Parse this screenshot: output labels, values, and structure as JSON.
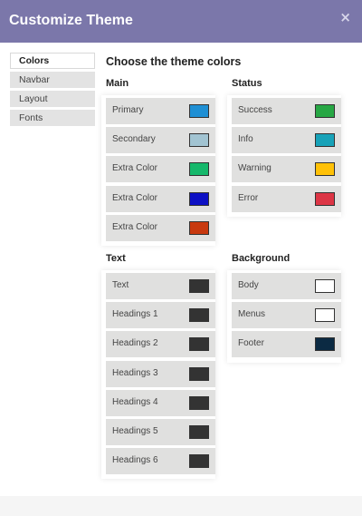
{
  "dialog": {
    "title": "Customize Theme",
    "close_glyph": "×"
  },
  "sidebar": {
    "items": [
      {
        "label": "Colors",
        "active": true
      },
      {
        "label": "Navbar",
        "active": false
      },
      {
        "label": "Layout",
        "active": false
      },
      {
        "label": "Fonts",
        "active": false
      }
    ]
  },
  "main": {
    "title": "Choose the theme colors",
    "groups": {
      "main": {
        "title": "Main",
        "items": [
          {
            "label": "Primary",
            "color": "#1e8fd4"
          },
          {
            "label": "Secondary",
            "color": "#a2c4d2"
          },
          {
            "label": "Extra Color",
            "color": "#16b86b"
          },
          {
            "label": "Extra Color",
            "color": "#0d10c4"
          },
          {
            "label": "Extra Color",
            "color": "#c8390f"
          }
        ]
      },
      "status": {
        "title": "Status",
        "items": [
          {
            "label": "Success",
            "color": "#27a744"
          },
          {
            "label": "Info",
            "color": "#17a2b8"
          },
          {
            "label": "Warning",
            "color": "#ffc107"
          },
          {
            "label": "Error",
            "color": "#dc3545"
          }
        ]
      },
      "text": {
        "title": "Text",
        "items": [
          {
            "label": "Text",
            "color": "#333333"
          },
          {
            "label": "Headings 1",
            "color": "#333333"
          },
          {
            "label": "Headings 2",
            "color": "#333333"
          },
          {
            "label": "Headings 3",
            "color": "#333333"
          },
          {
            "label": "Headings 4",
            "color": "#333333"
          },
          {
            "label": "Headings 5",
            "color": "#333333"
          },
          {
            "label": "Headings 6",
            "color": "#333333"
          }
        ]
      },
      "background": {
        "title": "Background",
        "items": [
          {
            "label": "Body",
            "color": "#ffffff"
          },
          {
            "label": "Menus",
            "color": "#ffffff"
          },
          {
            "label": "Footer",
            "color": "#0b2a43"
          }
        ]
      }
    }
  }
}
